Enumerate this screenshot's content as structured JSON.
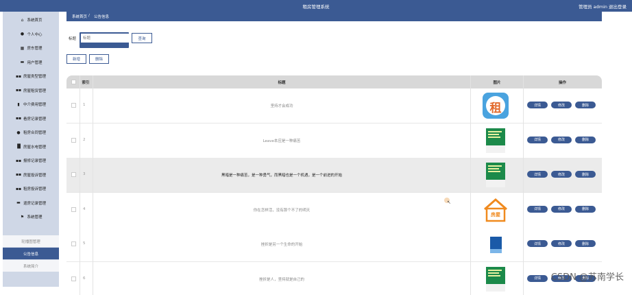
{
  "header": {
    "title": "租房管理系统",
    "user": "管理员 admin",
    "logout": "退出登录"
  },
  "sidebar": {
    "items": [
      {
        "label": "系统首页",
        "icon": "home-icon",
        "glyph": "⌂"
      },
      {
        "label": "个人中心",
        "icon": "person-icon",
        "glyph": "●"
      },
      {
        "label": "房东管理",
        "icon": "grid-icon",
        "glyph": "▦"
      },
      {
        "label": "用户管理",
        "icon": "briefcase-icon",
        "glyph": "▬"
      },
      {
        "label": "房屋类型管理",
        "icon": "apps-icon",
        "glyph": "▪▪"
      },
      {
        "label": "房屋租赁管理",
        "icon": "apps-icon",
        "glyph": "▪▪"
      },
      {
        "label": "中介费用管理",
        "icon": "receipt-icon",
        "glyph": "▮"
      },
      {
        "label": "看房记录管理",
        "icon": "apps-icon",
        "glyph": "▪▪"
      },
      {
        "label": "租房合同管理",
        "icon": "person-icon",
        "glyph": "●"
      },
      {
        "label": "房屋水电管理",
        "icon": "chart-icon",
        "glyph": "▐▌"
      },
      {
        "label": "报修记录管理",
        "icon": "apps-icon",
        "glyph": "▪▪"
      },
      {
        "label": "房屋投诉管理",
        "icon": "apps-icon",
        "glyph": "▪▪"
      },
      {
        "label": "租房投诉管理",
        "icon": "apps-icon",
        "glyph": "▪▪"
      },
      {
        "label": "退房记录管理",
        "icon": "chat-icon",
        "glyph": "▬"
      },
      {
        "label": "系统管理",
        "icon": "flag-icon",
        "glyph": "⚑"
      }
    ],
    "subitems": [
      {
        "label": "轮播图管理",
        "active": false
      },
      {
        "label": "公告信息",
        "active": true
      },
      {
        "label": "系统简介",
        "active": false
      }
    ]
  },
  "breadcrumb": {
    "home": "系统首页",
    "sep": "/",
    "current": "公告信息"
  },
  "search": {
    "label": "标题",
    "placeholder": "标题",
    "button": "查询"
  },
  "toolbar": {
    "add": "新增",
    "delete": "删除"
  },
  "table": {
    "columns": {
      "index": "索引",
      "title": "标题",
      "image": "图片",
      "actions": "操作"
    },
    "action_labels": {
      "detail": "详情",
      "edit": "修改",
      "delete": "删除"
    },
    "rows": [
      {
        "index": "1",
        "title": "坚持才会成功",
        "image": "rent-logo"
      },
      {
        "index": "2",
        "title": "Leave本应是一种痛苦",
        "image": "green-book"
      },
      {
        "index": "3",
        "title": "黑暗是一种痛苦，是一种勇气，而黑暗也是一个机遇，是一个前进的开始",
        "image": "green-book"
      },
      {
        "index": "4",
        "title": "你在怎样活，没有那个不了的明天",
        "image": "house-logo"
      },
      {
        "index": "5",
        "title": "挫折是另一个生命的开始",
        "image": "blue-book"
      },
      {
        "index": "6",
        "title": "挫折是人，坚持就是自己的",
        "image": "green-book"
      }
    ]
  },
  "logos": {
    "rent": "租",
    "house": "房屋"
  },
  "watermark": "CSDN @苏南学长",
  "colors": {
    "primary": "#3b5a93",
    "sidebar": "#cfd7e6",
    "header_row": "#d8d8d8"
  }
}
